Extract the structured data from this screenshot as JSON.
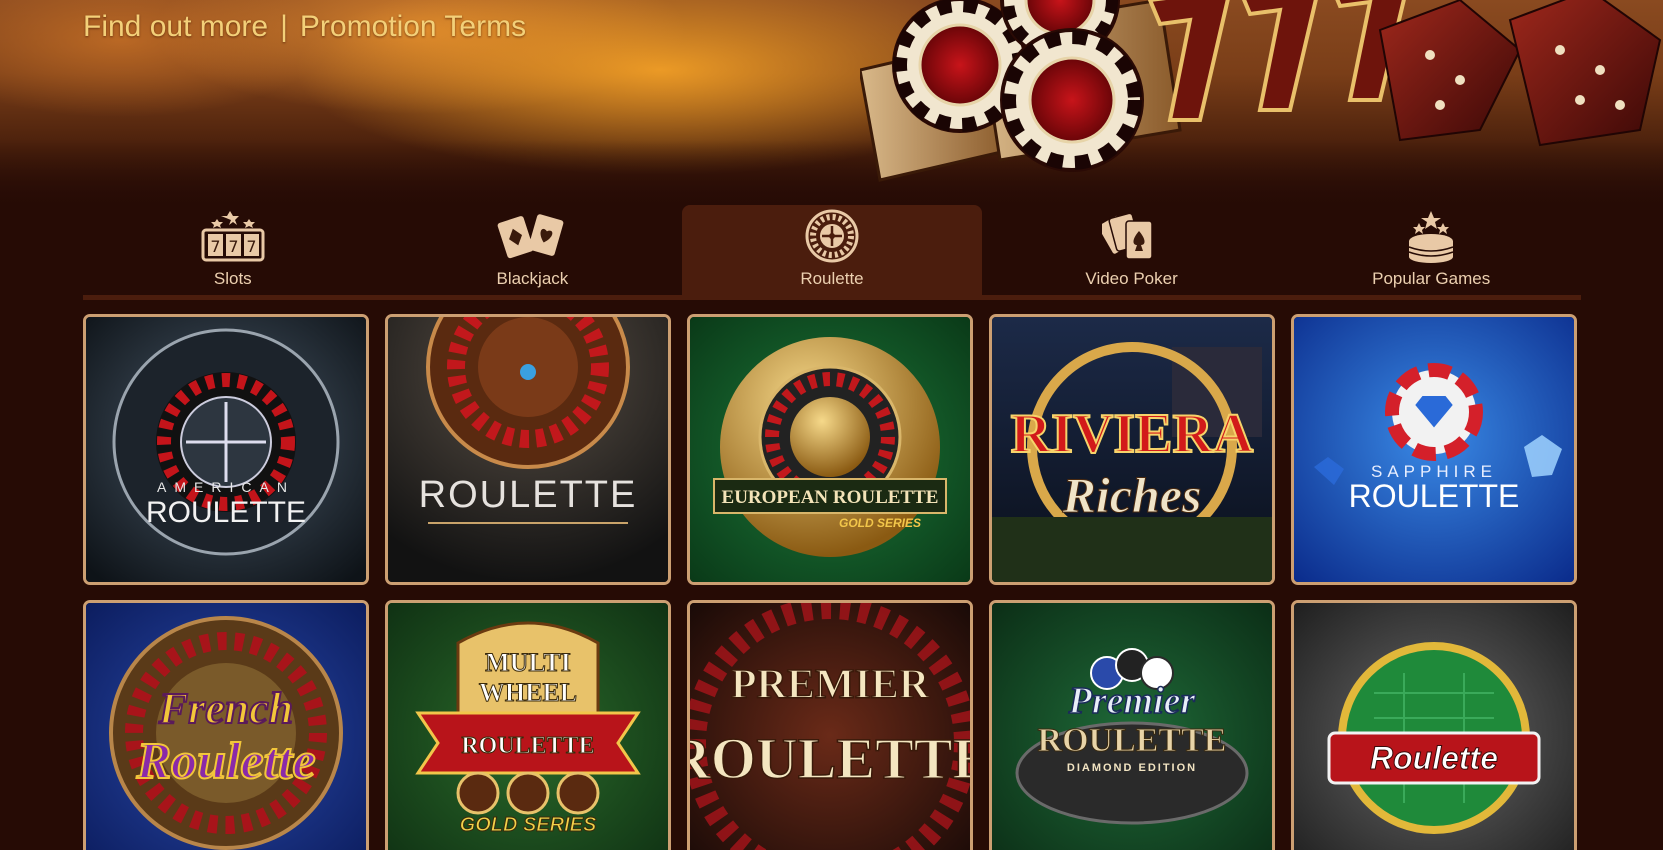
{
  "hero": {
    "find_out_more": "Find out more",
    "separator": "|",
    "promotion_terms": "Promotion Terms"
  },
  "tabs": [
    {
      "label": "Slots",
      "icon": "slots-777-icon",
      "active": false
    },
    {
      "label": "Blackjack",
      "icon": "playing-cards-icon",
      "active": false
    },
    {
      "label": "Roulette",
      "icon": "roulette-wheel-icon",
      "active": true
    },
    {
      "label": "Video Poker",
      "icon": "card-fan-icon",
      "active": false
    },
    {
      "label": "Popular Games",
      "icon": "chip-stack-star-icon",
      "active": false
    }
  ],
  "games": [
    {
      "title_lines": [
        "AMERICAN",
        "ROULETTE"
      ],
      "theme": "dark-silver"
    },
    {
      "title_lines": [
        "ROULETTE"
      ],
      "theme": "dark-gold"
    },
    {
      "title_lines": [
        "EUROPEAN ROULETTE",
        "GOLD SERIES"
      ],
      "theme": "green-gold"
    },
    {
      "title_lines": [
        "RIVIERA",
        "Riches"
      ],
      "theme": "night-red"
    },
    {
      "title_lines": [
        "SAPPHIRE",
        "ROULETTE"
      ],
      "theme": "blue"
    },
    {
      "title_lines": [
        "French",
        "Roulette"
      ],
      "theme": "blue-purple"
    },
    {
      "title_lines": [
        "MULTI",
        "WHEEL",
        "ROULETTE",
        "GOLD SERIES"
      ],
      "theme": "green-gold"
    },
    {
      "title_lines": [
        "PREMIER",
        "ROULETTE"
      ],
      "theme": "dark-cream"
    },
    {
      "title_lines": [
        "Premier",
        "ROULETTE",
        "DIAMOND EDITION"
      ],
      "theme": "green-silver"
    },
    {
      "title_lines": [
        "Roulette"
      ],
      "theme": "grey-green"
    }
  ],
  "colors": {
    "background": "#260b05",
    "tab_active": "#4b1d0d",
    "card_border": "#cc9f72",
    "hero_link": "#f3d079"
  }
}
